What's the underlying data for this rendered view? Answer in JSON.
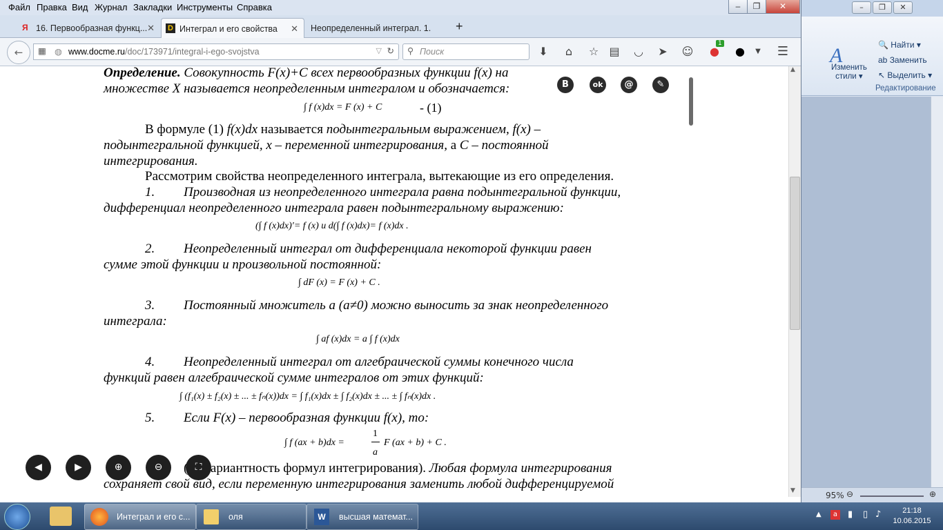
{
  "browser": {
    "menu": [
      "Файл",
      "Правка",
      "Вид",
      "Журнал",
      "Закладки",
      "Инструменты",
      "Справка"
    ],
    "tabs": [
      {
        "label": "16. Первообразная функц...",
        "active": false
      },
      {
        "label": "Интеграл и его свойства",
        "active": true
      },
      {
        "label": "Неопределенный интеграл. 1.",
        "active": false
      }
    ],
    "new_tab": "+",
    "url_host": "www.docme.ru",
    "url_path": "/doc/173971/integral-i-ego-svojstva",
    "search_placeholder": "Поиск",
    "notification_badge": "1"
  },
  "share_icons": [
    "В",
    "ok",
    "@",
    "✎"
  ],
  "document": {
    "def_line1_bold": "Определение.",
    "def_line1_rest": " Совокупность  F(x)+C  всех  первообразных  функции  f(x)  на",
    "def_line2": "множестве X называется неопределенным интегралом и обозначается:",
    "f1": "∫ f (x)dx  =  F (x) + C",
    "f1_num": "- (1)",
    "p1_a": "В  формуле  (1)  ",
    "p1_b": "f(x)dx",
    "p1_c": "  называется  ",
    "p1_d": "подынтегральным  выражением,  f(x)  –",
    "p1_line2": "подынтегральной  функцией,  x  –  переменной  интегрирования,",
    "p1_line2b": "  а  ",
    "p1_line2c": "С  –  постоянной",
    "p1_line3": "интегрирования.",
    "p2": "Рассмотрим свойства неопределенного интеграла, вытекающие из его определения.",
    "item1_num": "1.",
    "item1_l1": "Производная из неопределенного интеграла равна подынтегральной функции,",
    "item1_l2": "дифференциал неопределенного интеграла равен подынтегральному выражению:",
    "f2": "(∫ f (x)dx)′=  f (x)   и   d(∫ f (x)dx)=  f (x)dx .",
    "item2_num": "2.",
    "item2_l1": "Неопределенный  интеграл  от  дифференциала  некоторой  функции  равен",
    "item2_l2": "сумме этой функции и произвольной постоянной:",
    "f3": "∫ dF (x) = F (x) + C .",
    "item3_num": "3.",
    "item3_l1": "Постоянный множитель a (a≠0) можно выносить за знак неопределенного",
    "item3_l2": "интеграла:",
    "f4": "∫ af (x)dx  =  a ∫ f (x)dx",
    "item4_num": "4.",
    "item4_l1": "Неопределенный  интеграл  от  алгебраической  суммы  конечного  числа",
    "item4_l2": "функций равен алгебраической сумме интегралов от этих функций:",
    "f5": "∫ (f₁(x) ± f₂(x) ± ... ± fₙ(x))dx  =  ∫ f₁(x)dx  ±  ∫ f₂(x)dx  ± ... ±  ∫ fₙ(x)dx .",
    "item5_num": "5.",
    "item5_l1": "Если F(x) – первообразная функции f(x), то:",
    "f6_left": "∫ f (ax + b)dx  =",
    "f6_num": "1",
    "f6_den": "a",
    "f6_right": "F (ax + b) + C .",
    "p3_a": "(Инвариантность формул интегрирования).",
    "p3_b": " Любая формула интегрирования",
    "p3_l2": "сохраняет свой вид, если переменную интегрирования заменить любой дифференцируемой"
  },
  "word": {
    "find": "Найти",
    "replace": "Заменить",
    "select": "Выделить",
    "change_styles_1": "Изменить",
    "change_styles_2": "стили",
    "group": "Редактирование",
    "zoom": "95%"
  },
  "taskbar": {
    "items": [
      {
        "label": "Интеграл и его с..."
      },
      {
        "label": "оля"
      },
      {
        "label": "высшая математ..."
      }
    ],
    "time": "21:18",
    "date": "10.06.2015"
  }
}
